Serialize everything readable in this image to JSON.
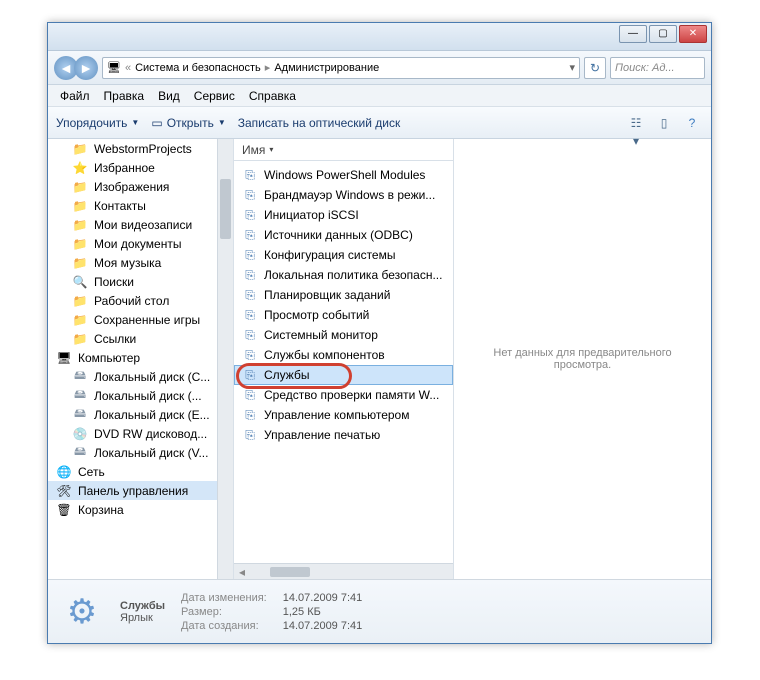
{
  "breadcrumb": {
    "root_icon": "🖥",
    "p1": "Система и безопасность",
    "p2": "Администрирование",
    "sep": "▸"
  },
  "search": {
    "placeholder": "Поиск: Ад..."
  },
  "menu": {
    "file": "Файл",
    "edit": "Правка",
    "view": "Вид",
    "tools": "Сервис",
    "help": "Справка"
  },
  "toolbar": {
    "organize": "Упорядочить",
    "open": "Открыть",
    "burn": "Записать на оптический диск"
  },
  "tree": [
    {
      "icon": "folder",
      "label": "WebstormProjects",
      "lvl": 1
    },
    {
      "icon": "star",
      "label": "Избранное",
      "lvl": 1
    },
    {
      "icon": "folder",
      "label": "Изображения",
      "lvl": 1
    },
    {
      "icon": "folder",
      "label": "Контакты",
      "lvl": 1
    },
    {
      "icon": "folder",
      "label": "Мои видеозаписи",
      "lvl": 1
    },
    {
      "icon": "folder",
      "label": "Мои документы",
      "lvl": 1
    },
    {
      "icon": "folder",
      "label": "Моя музыка",
      "lvl": 1
    },
    {
      "icon": "search",
      "label": "Поиски",
      "lvl": 1
    },
    {
      "icon": "folder",
      "label": "Рабочий стол",
      "lvl": 1
    },
    {
      "icon": "folder",
      "label": "Сохраненные игры",
      "lvl": 1
    },
    {
      "icon": "folder",
      "label": "Ссылки",
      "lvl": 1
    },
    {
      "icon": "computer",
      "label": "Компьютер",
      "lvl": 0
    },
    {
      "icon": "drive",
      "label": "Локальный диск (C...",
      "lvl": 1
    },
    {
      "icon": "drive",
      "label": "Локальный диск (...",
      "lvl": 1
    },
    {
      "icon": "drive",
      "label": "Локальный диск (E...",
      "lvl": 1
    },
    {
      "icon": "dvd",
      "label": "DVD RW дисковод...",
      "lvl": 1
    },
    {
      "icon": "drive",
      "label": "Локальный диск (V...",
      "lvl": 1
    },
    {
      "icon": "network",
      "label": "Сеть",
      "lvl": 0
    },
    {
      "icon": "cpanel",
      "label": "Панель управления",
      "lvl": 0,
      "sel": true
    },
    {
      "icon": "bin",
      "label": "Корзина",
      "lvl": 0
    }
  ],
  "columns": {
    "name": "Имя"
  },
  "items": [
    {
      "label": "Windows PowerShell Modules"
    },
    {
      "label": "Брандмауэр Windows в режи..."
    },
    {
      "label": "Инициатор iSCSI"
    },
    {
      "label": "Источники данных (ODBC)"
    },
    {
      "label": "Конфигурация системы"
    },
    {
      "label": "Локальная политика безопасн..."
    },
    {
      "label": "Планировщик заданий"
    },
    {
      "label": "Просмотр событий"
    },
    {
      "label": "Системный монитор"
    },
    {
      "label": "Службы компонентов"
    },
    {
      "label": "Службы",
      "sel": true
    },
    {
      "label": "Средство проверки памяти W..."
    },
    {
      "label": "Управление компьютером"
    },
    {
      "label": "Управление печатью"
    }
  ],
  "preview": {
    "empty": "Нет данных для предварительного просмотра."
  },
  "details": {
    "name": "Службы",
    "type": "Ярлык",
    "modified_label": "Дата изменения:",
    "modified": "14.07.2009 7:41",
    "size_label": "Размер:",
    "size": "1,25 КБ",
    "created_label": "Дата создания:",
    "created": "14.07.2009 7:41"
  }
}
